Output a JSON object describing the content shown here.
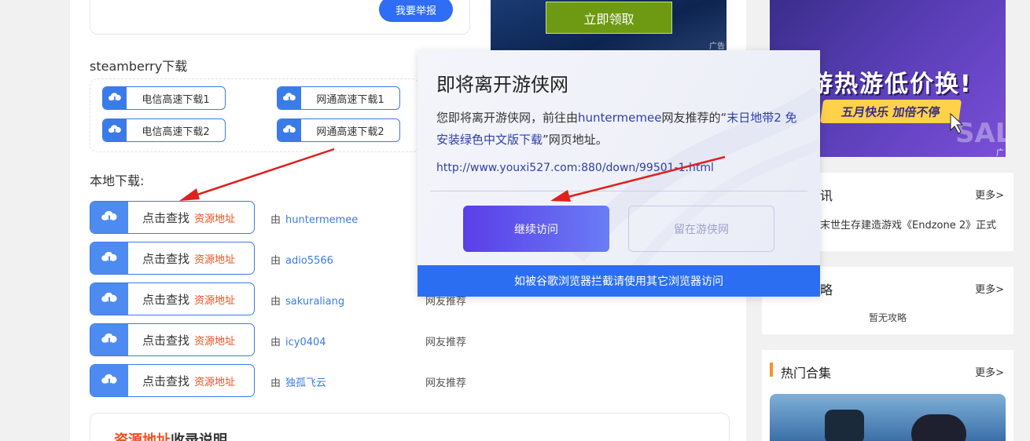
{
  "report": {
    "button_label": "我要举报"
  },
  "steamberry": {
    "title": "steamberry下载",
    "buttons": [
      "电信高速下载1",
      "网通高速下载1",
      "电信高速下载2",
      "网通高速下载2"
    ]
  },
  "local": {
    "title": "本地下载:",
    "click_text": "点击查找",
    "resource_text": "资源地址",
    "by_prefix": "由",
    "recommend_text": "网友推荐",
    "rows": [
      {
        "user": "huntermemee"
      },
      {
        "user": "adio5566"
      },
      {
        "user": "sakuraliang"
      },
      {
        "user": "icy0404"
      },
      {
        "user": "独孤飞云"
      }
    ]
  },
  "resource_note": {
    "title_red": "资源地址",
    "title_rest": "收录说明"
  },
  "ad_center": {
    "button_label": "立即领取",
    "tag": "广告"
  },
  "ad_right": {
    "headline": "游热游低价换!",
    "pill": "五月快乐 加倍不停",
    "tag": "广告",
    "corner": "SAL"
  },
  "side": {
    "news": {
      "title_partial": "讯",
      "more": "更多>",
      "item": "末世生存建造游戏《Endzone 2》正式"
    },
    "guide": {
      "title_partial": "略",
      "more": "更多>",
      "empty": "暂无攻略"
    },
    "hot": {
      "title": "热门合集",
      "more": "更多>"
    }
  },
  "modal": {
    "title": "即将离开游侠网",
    "desc_before": "您即将离开游侠网，前往由",
    "desc_user": "huntermemee",
    "desc_mid": "网友推荐的“",
    "desc_link": "末日地带2 免安装绿色中文版下载",
    "desc_after": "”网页地址。",
    "url": "http://www.youxi527.com:880/down/99501-1.html",
    "continue_label": "继续访问",
    "stay_label": "留在游侠网",
    "footer": "如被谷歌浏览器拦截请使用其它浏览器访问"
  },
  "colors": {
    "accent": "#3a7be8",
    "highlight": "#f04e1e",
    "modal_footer": "#2b6ef2",
    "arrow": "#e0201c"
  }
}
